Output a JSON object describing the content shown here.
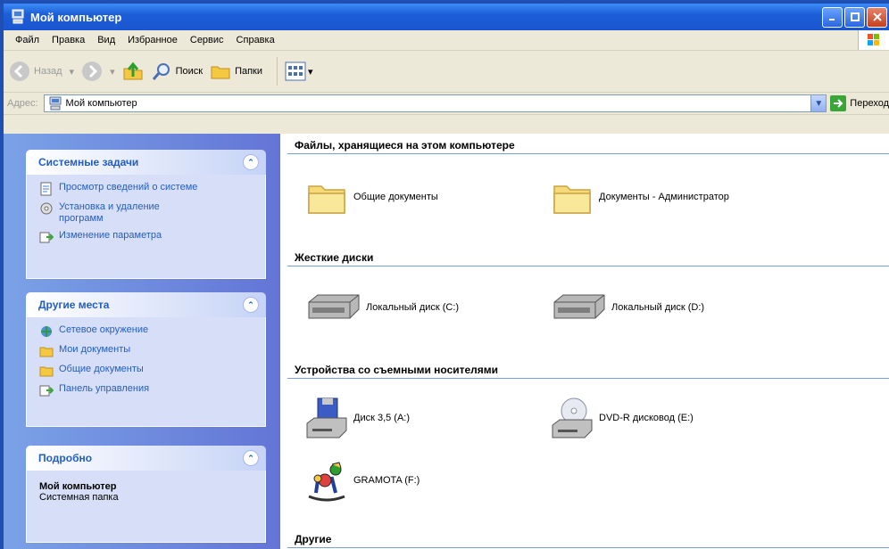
{
  "window": {
    "title": "Мой компьютер"
  },
  "menu": [
    "Файл",
    "Правка",
    "Вид",
    "Избранное",
    "Сервис",
    "Справка"
  ],
  "toolbar": {
    "back": "Назад",
    "search": "Поиск",
    "folders": "Папки"
  },
  "address": {
    "label": "Адрес:",
    "value": "Мой компьютер",
    "go": "Переход"
  },
  "tasks": {
    "system": {
      "title": "Системные задачи",
      "items": [
        "Просмотр сведений о системе",
        "Установка и удаление программ",
        "Изменение параметра"
      ]
    },
    "places": {
      "title": "Другие места",
      "items": [
        "Сетевое окружение",
        "Мои документы",
        "Общие документы",
        "Панель управления"
      ]
    },
    "details": {
      "title": "Подробно",
      "name": "Мой компьютер",
      "desc": "Системная папка"
    }
  },
  "groups": {
    "files": {
      "title": "Файлы, хранящиеся на этом компьютере",
      "items": [
        "Общие документы",
        "Документы - Администратор"
      ]
    },
    "drives": {
      "title": "Жесткие диски",
      "items": [
        "Локальный диск (C:)",
        "Локальный диск (D:)"
      ]
    },
    "removable": {
      "title": "Устройства со съемными носителями",
      "items": [
        "Диск 3,5 (A:)",
        "DVD-R дисковод (E:)",
        "GRAMOTA (F:)"
      ]
    },
    "other": {
      "title": "Другие"
    }
  }
}
